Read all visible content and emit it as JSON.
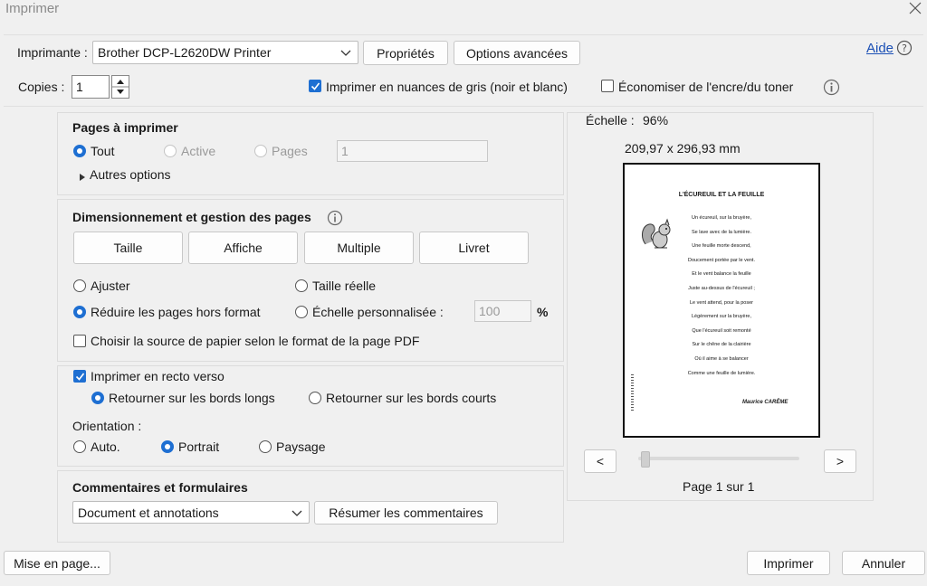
{
  "window": {
    "title": "Imprimer"
  },
  "printer": {
    "label": "Imprimante :",
    "selected": "Brother DCP-L2620DW Printer",
    "properties_button": "Propriétés",
    "advanced_button": "Options avancées",
    "help_link": "Aide"
  },
  "copies": {
    "label": "Copies :",
    "value": "1",
    "grayscale_label": "Imprimer en nuances de gris (noir et blanc)",
    "grayscale_checked": true,
    "save_ink_label": "Économiser de l'encre/du toner",
    "save_ink_checked": false
  },
  "pages_section": {
    "title": "Pages à imprimer",
    "all_label": "Tout",
    "active_label": "Active",
    "pages_label": "Pages",
    "pages_value": "1",
    "more_options": "Autres options"
  },
  "sizing_section": {
    "title": "Dimensionnement et gestion des pages",
    "tabs": [
      "Taille",
      "Affiche",
      "Multiple",
      "Livret"
    ],
    "fit_label": "Ajuster",
    "actual_size_label": "Taille réelle",
    "shrink_label": "Réduire les pages hors format",
    "custom_scale_label": "Échelle personnalisée :",
    "custom_scale_value": "100",
    "percent": "%",
    "paper_source_label": "Choisir la source de papier selon le format de la page PDF"
  },
  "duplex_section": {
    "duplex_label": "Imprimer en recto verso",
    "long_edge_label": "Retourner sur les bords longs",
    "short_edge_label": "Retourner sur les bords courts",
    "orientation_label": "Orientation :",
    "auto_label": "Auto.",
    "portrait_label": "Portrait",
    "landscape_label": "Paysage"
  },
  "comments_section": {
    "title": "Commentaires et formulaires",
    "selected": "Document et annotations",
    "summarize_button": "Résumer les commentaires"
  },
  "preview": {
    "scale_label": "Échelle :",
    "scale_value": "96%",
    "dimensions": "209,97 x 296,93 mm",
    "prev": "<",
    "next": ">",
    "page_info": "Page 1 sur 1",
    "doc": {
      "title": "L'ÉCUREUIL ET LA FEUILLE",
      "lines": [
        "Un écureuil, sur la bruyère,",
        "Se lave avec de la lumière.",
        "Une feuille morte descend,",
        "Doucement portée par le vent.",
        "Et le vent balance la feuille",
        "Juste au-dessus de l'écureuil ;",
        "Le vent attend, pour la poser",
        "Légèrement sur la bruyère,",
        "Que l'écureuil soit remonté",
        "Sur le chêne de la clairière",
        "Où il aime à se balancer",
        "Comme une feuille de lumière."
      ],
      "author": "Maurice CARÊME"
    }
  },
  "footer": {
    "page_setup_button": "Mise en page...",
    "print_button": "Imprimer",
    "cancel_button": "Annuler"
  },
  "colors": {
    "accent": "#1e6fd2",
    "help_link": "#1a4fb5"
  }
}
